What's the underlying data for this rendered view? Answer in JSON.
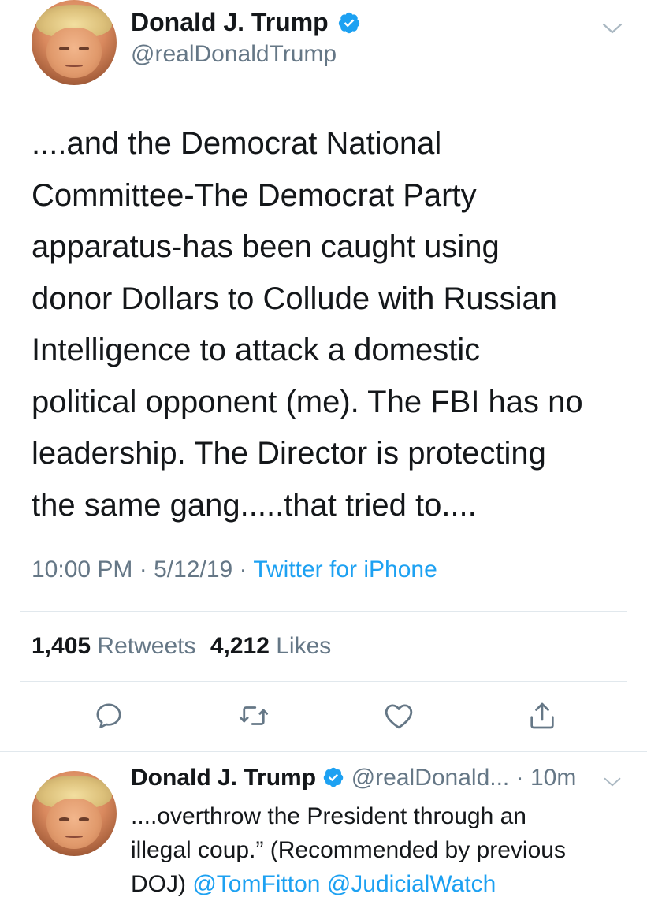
{
  "tweet": {
    "author_name": "Donald J. Trump",
    "author_handle": "@realDonaldTrump",
    "text_lines": [
      "....and the Democrat National",
      "Committee-The Democrat Party",
      "apparatus-has been caught using",
      "donor Dollars to Collude with Russian",
      "Intelligence to attack a domestic",
      "political opponent (me). The FBI has no",
      "leadership. The Director is protecting",
      "the same gang.....that tried to...."
    ],
    "time": "10:00 PM",
    "date": "5/12/19",
    "source": "Twitter for iPhone",
    "retweets_count": "1,405",
    "retweets_label": "Retweets",
    "likes_count": "4,212",
    "likes_label": "Likes"
  },
  "reply": {
    "author_name": "Donald J. Trump",
    "author_handle": "@realDonald...",
    "time_ago": "10m",
    "text_line1": "....overthrow the President through an",
    "text_line2": "illegal coup.” (Recommended by previous",
    "text_line3_prefix": "DOJ) ",
    "mention1": "@TomFitton",
    "mention2": "@JudicialWatch"
  },
  "icons": {
    "verified": "verified-badge-icon",
    "caret": "chevron-down-icon",
    "reply": "reply-icon",
    "retweet": "retweet-icon",
    "like": "heart-icon",
    "share": "share-icon"
  },
  "colors": {
    "text": "#14171a",
    "secondary": "#657786",
    "accent": "#1da1f2",
    "divider": "#e1e8ed"
  }
}
